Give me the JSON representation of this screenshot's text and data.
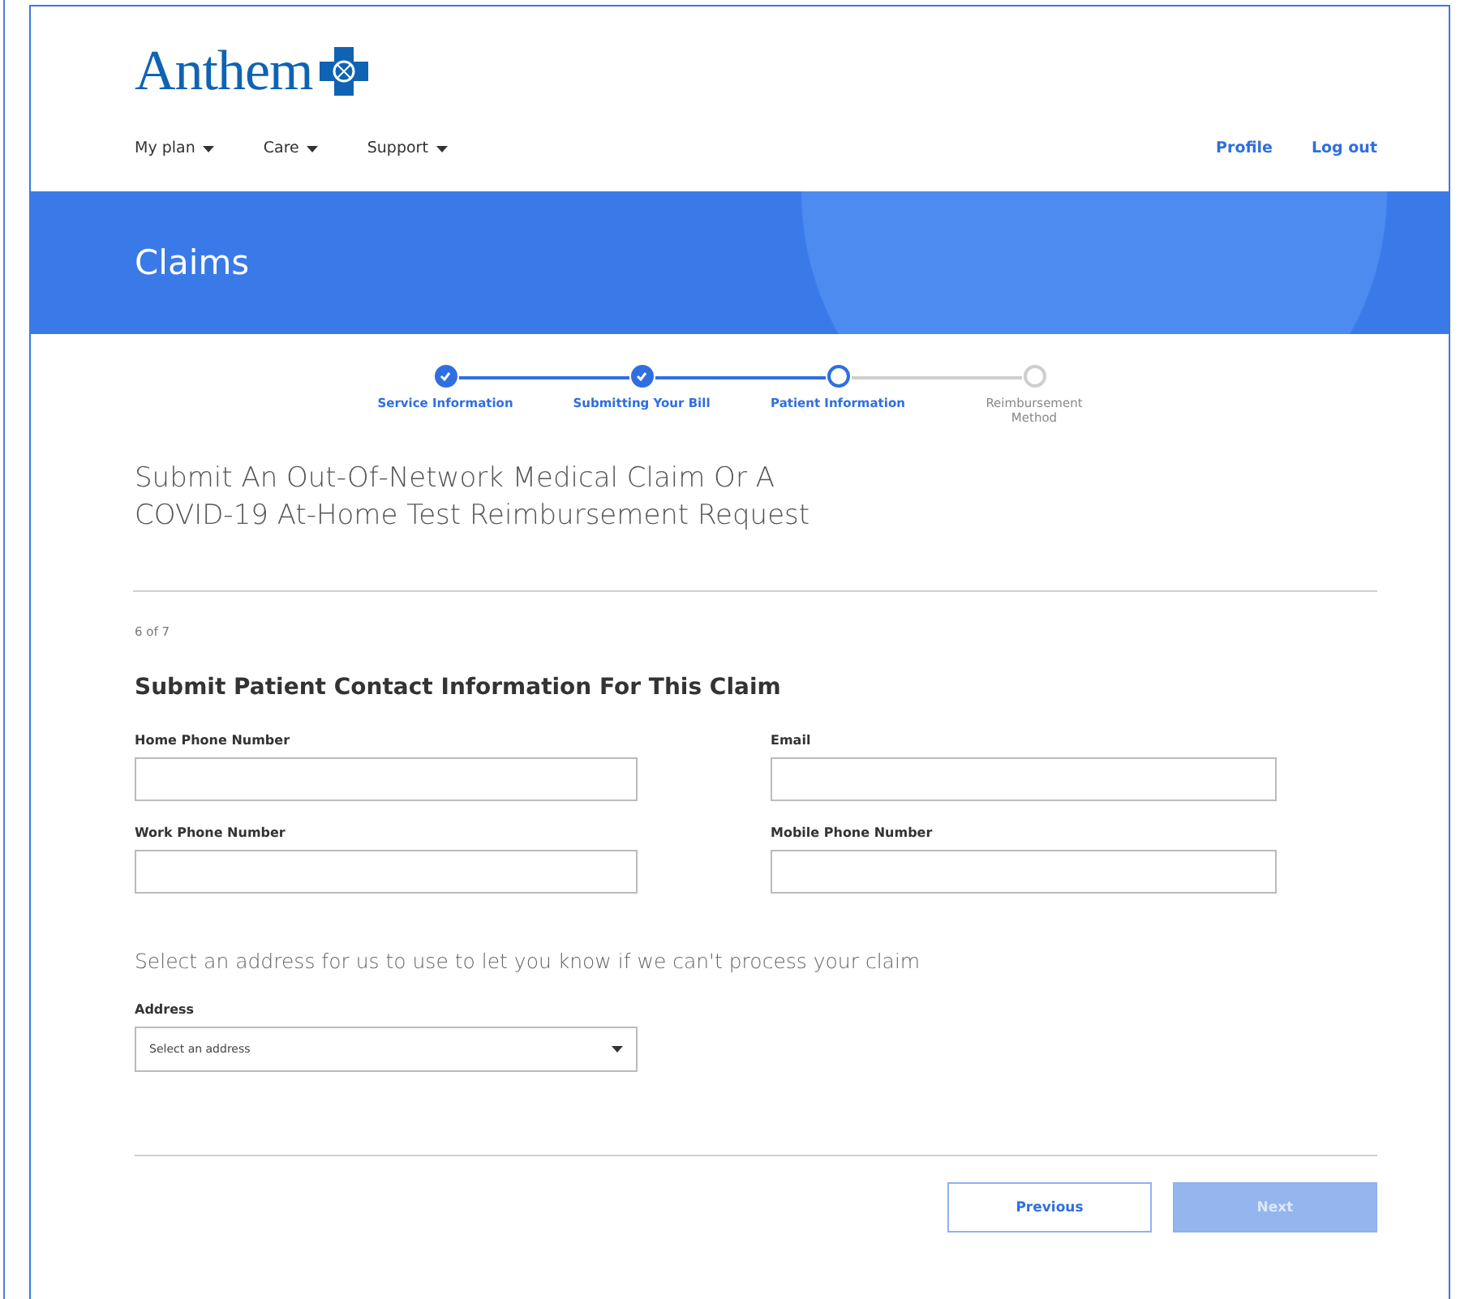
{
  "header": {
    "logo": "Anthem",
    "nav": [
      {
        "label": "My plan"
      },
      {
        "label": "Care"
      },
      {
        "label": "Support"
      }
    ],
    "links": [
      "Profile",
      "Log out"
    ]
  },
  "banner": {
    "title": "Claims"
  },
  "steps": [
    {
      "label": "Service Information",
      "done": true,
      "selected": false
    },
    {
      "label": "Submitting Your Bill",
      "done": true,
      "selected": false
    },
    {
      "label": "Patient Information",
      "done": false,
      "selected": true
    },
    {
      "label": "Reimbursement Method",
      "done": false,
      "selected": false
    }
  ],
  "page_title": "Submit An Out-Of-Network Medical Claim Or A COVID-19 At-Home Test Reimbursement Request",
  "progress": "6 of 7",
  "section_title": "Submit Patient Contact Information For This Claim",
  "fields": [
    {
      "label": "Home Phone Number"
    },
    {
      "label": "Email"
    },
    {
      "label": "Work Phone Number"
    },
    {
      "label": "Mobile Phone Number"
    }
  ],
  "address_prompt": "Select an address for us to use to let you know if we can't process your claim",
  "address": {
    "label": "Address",
    "placeholder": "Select an address"
  },
  "buttons": [
    {
      "label": "Previous",
      "kind": "secondary",
      "disabled": false
    },
    {
      "label": "Next",
      "kind": "primary",
      "disabled": true
    }
  ]
}
